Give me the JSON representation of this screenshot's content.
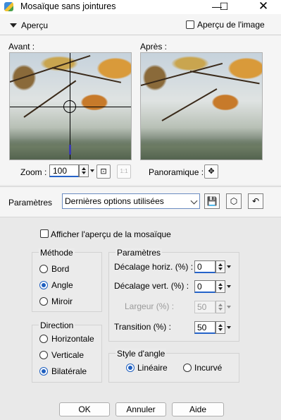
{
  "window": {
    "title": "Mosaïque sans jointures",
    "minimize_glyph": "—",
    "maximize_glyph": "☐",
    "close_glyph": "✕"
  },
  "preview": {
    "section_label": "Aperçu",
    "image_preview_label": "Aperçu de l'image",
    "image_preview_checked": false,
    "before_label": "Avant :",
    "after_label": "Après :",
    "zoom_label": "Zoom :",
    "zoom_value": "100",
    "pan_label": "Panoramique :",
    "zoom_fit_glyph": "⊡",
    "zoom_actual_glyph": "1:1",
    "pan_glyph": "✥"
  },
  "presets": {
    "label": "Paramètres",
    "selected": "Dernières options utilisées"
  },
  "mosaic_preview": {
    "label": "Afficher l'aperçu de la mosaïque",
    "checked": false
  },
  "method": {
    "title": "Méthode",
    "options": [
      "Bord",
      "Angle",
      "Miroir"
    ],
    "selected": "Angle"
  },
  "direction": {
    "title": "Direction",
    "options": [
      "Horizontale",
      "Verticale",
      "Bilatérale"
    ],
    "selected": "Bilatérale"
  },
  "parameters": {
    "title": "Paramètres",
    "horiz_offset_label": "Décalage horiz. (%) :",
    "horiz_offset_value": "0",
    "vert_offset_label": "Décalage vert. (%) :",
    "vert_offset_value": "0",
    "width_label": "Largeur (%) :",
    "width_value": "50",
    "transition_label": "Transition (%) :",
    "transition_value": "50"
  },
  "corner_style": {
    "title": "Style d'angle",
    "options": [
      "Linéaire",
      "Incurvé"
    ],
    "selected": "Linéaire"
  },
  "buttons": {
    "ok": "OK",
    "cancel": "Annuler",
    "help": "Aide"
  }
}
